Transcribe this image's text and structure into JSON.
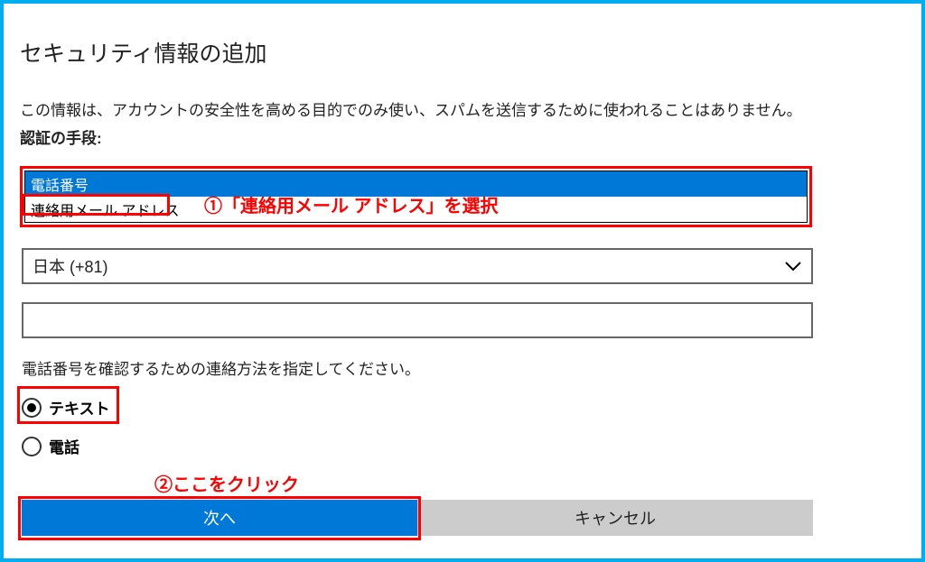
{
  "title": "セキュリティ情報の追加",
  "description": "この情報は、アカウントの安全性を高める目的でのみ使い、スパムを送信するために使われることはありません。",
  "method_label": "認証の手段:",
  "dropdown": {
    "options": [
      "電話番号",
      "連絡用メール アドレス"
    ],
    "highlighted": "電話番号"
  },
  "annotation1": "①「連絡用メール アドレス」を選択",
  "country": {
    "label": "日本 (+81)"
  },
  "phone_input": {
    "value": ""
  },
  "contact_instruction": "電話番号を確認するための連絡方法を指定してください。",
  "radios": {
    "text_label": "テキスト",
    "phone_label": "電話",
    "selected": "text"
  },
  "annotation2": "②ここをクリック",
  "buttons": {
    "next": "次へ",
    "cancel": "キャンセル"
  }
}
